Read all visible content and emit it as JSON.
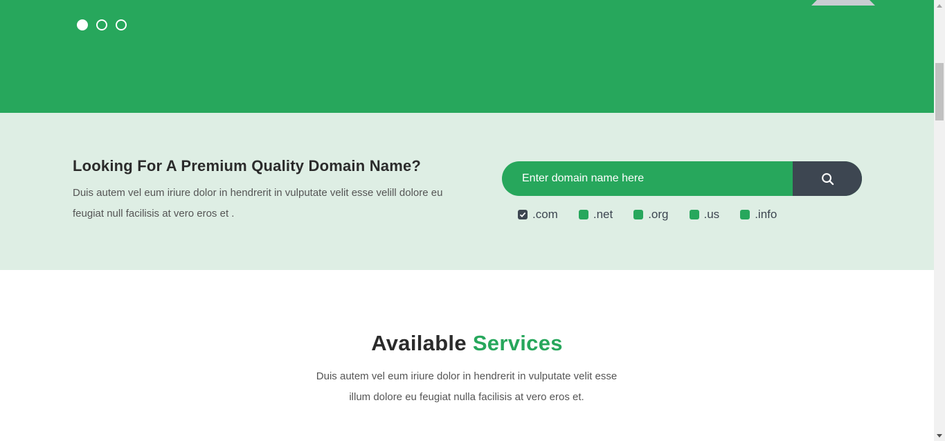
{
  "hero": {
    "slides": 3,
    "active_slide": 1,
    "bg_color": "#27a75c"
  },
  "domain_search": {
    "title": "Looking For A Premium Quality Domain Name?",
    "description": "Duis autem vel eum iriure dolor in hendrerit in vulputate velit esse velill dolore eu feugiat null facilisis at vero eros et .",
    "input_placeholder": "Enter domain name here",
    "search_icon": "search-icon",
    "tlds": [
      {
        "label": ".com",
        "checked": true
      },
      {
        "label": ".net",
        "checked": false
      },
      {
        "label": ".org",
        "checked": false
      },
      {
        "label": ".us",
        "checked": false
      },
      {
        "label": ".info",
        "checked": false
      }
    ],
    "bg_color": "#deeee4"
  },
  "services": {
    "title_dark": "Available",
    "title_accent": "Services",
    "description_line1": "Duis autem vel eum iriure dolor in hendrerit in vulputate velit esse",
    "description_line2": "illum dolore eu feugiat nulla facilisis at vero eros et."
  },
  "colors": {
    "accent": "#27a75c",
    "dark": "#3d4651",
    "text": "#2b2b2b",
    "muted": "#555555"
  }
}
